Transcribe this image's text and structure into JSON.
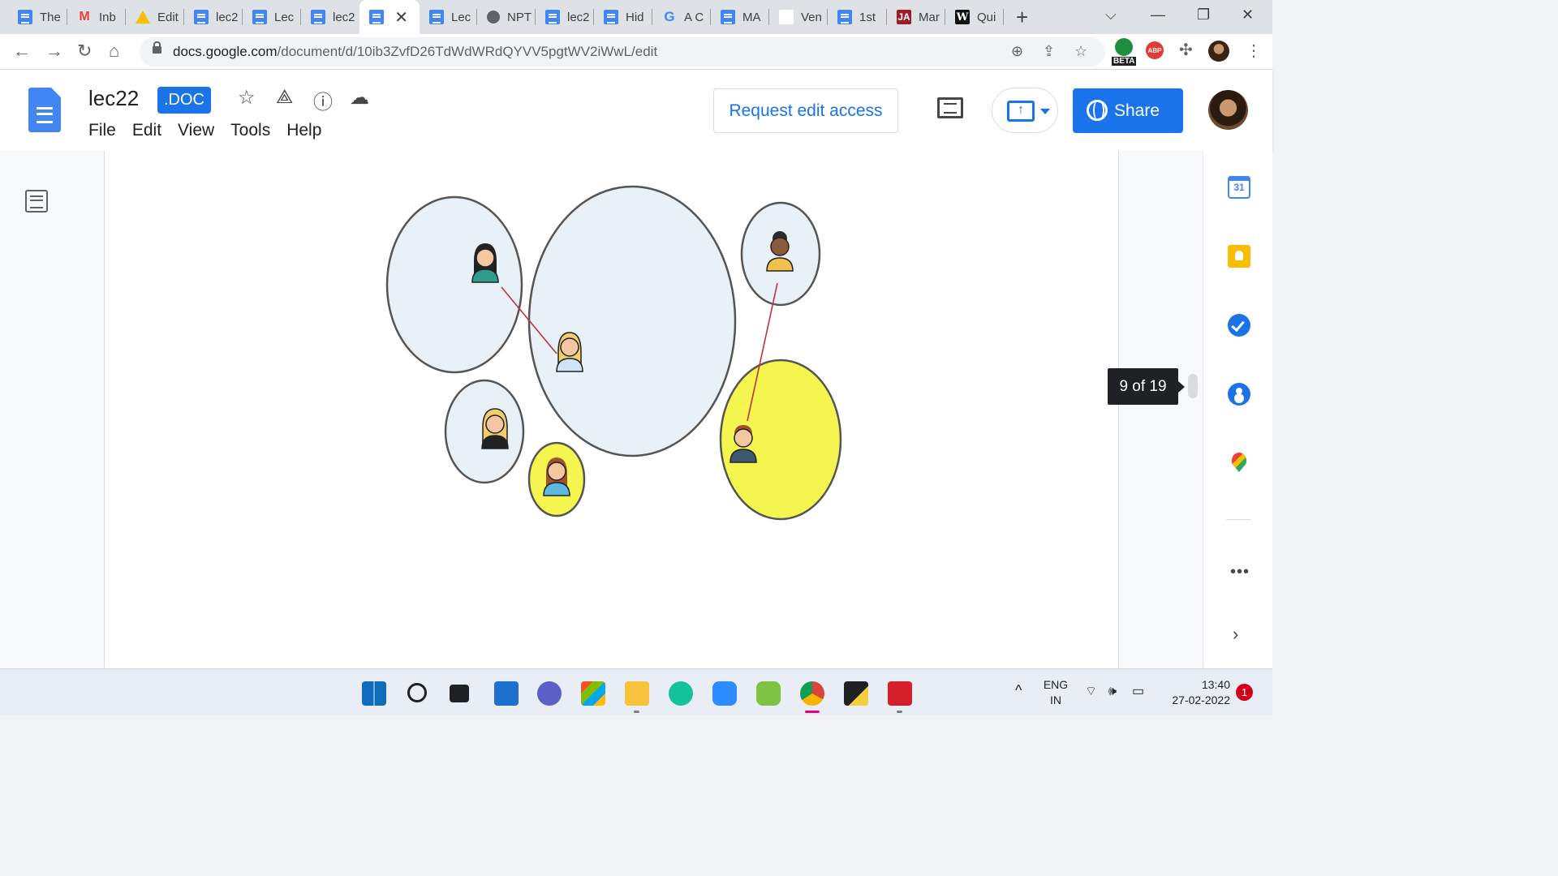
{
  "browser": {
    "tabs": [
      {
        "title": "The",
        "icon": "docs-icon"
      },
      {
        "title": "Inb",
        "icon": "gmail-icon"
      },
      {
        "title": "Edit",
        "icon": "drive-icon"
      },
      {
        "title": "lec2",
        "icon": "docs-icon"
      },
      {
        "title": "Lec",
        "icon": "docs-icon"
      },
      {
        "title": "lec2",
        "icon": "docs-icon"
      },
      {
        "title": "",
        "icon": "docs-icon",
        "active": true
      },
      {
        "title": "Lec",
        "icon": "docs-icon"
      },
      {
        "title": "NPT",
        "icon": "globe-icon"
      },
      {
        "title": "lec2",
        "icon": "docs-icon"
      },
      {
        "title": "Hid",
        "icon": "docs-icon"
      },
      {
        "title": "A C",
        "icon": "google-icon"
      },
      {
        "title": "MA",
        "icon": "docs-icon"
      },
      {
        "title": "Ven",
        "icon": "blank-icon"
      },
      {
        "title": "1st",
        "icon": "docs-icon"
      },
      {
        "title": "Mar",
        "icon": "ja-icon",
        "badge": "JA"
      },
      {
        "title": "Qui",
        "icon": "w-icon",
        "badge": "W"
      }
    ],
    "url_host": "docs.google.com",
    "url_path": "/document/d/10ib3ZvfD26TdWdWRdQYVV5pgtWV2iWwL/edit",
    "extension_beta_label": "BETA",
    "extension_abp_label": "ABP"
  },
  "docs": {
    "title": "lec22",
    "format_badge": ".DOC",
    "menu": [
      "File",
      "Edit",
      "View",
      "Tools",
      "Help"
    ],
    "request_edit_label": "Request edit access",
    "share_label": "Share",
    "page_indicator": "9 of 19"
  },
  "side_panel": {
    "calendar_day": "31",
    "more_label": "•••",
    "chevron": "›"
  },
  "taskbar": {
    "lang_line1": "ENG",
    "lang_line2": "IN",
    "time": "13:40",
    "date": "27-02-2022",
    "notifications": "1"
  },
  "colors": {
    "bubble_blue": "#e8f0f8",
    "bubble_yellow": "#f5f550",
    "link_red": "#c2323a",
    "accent": "#1a73e8"
  }
}
